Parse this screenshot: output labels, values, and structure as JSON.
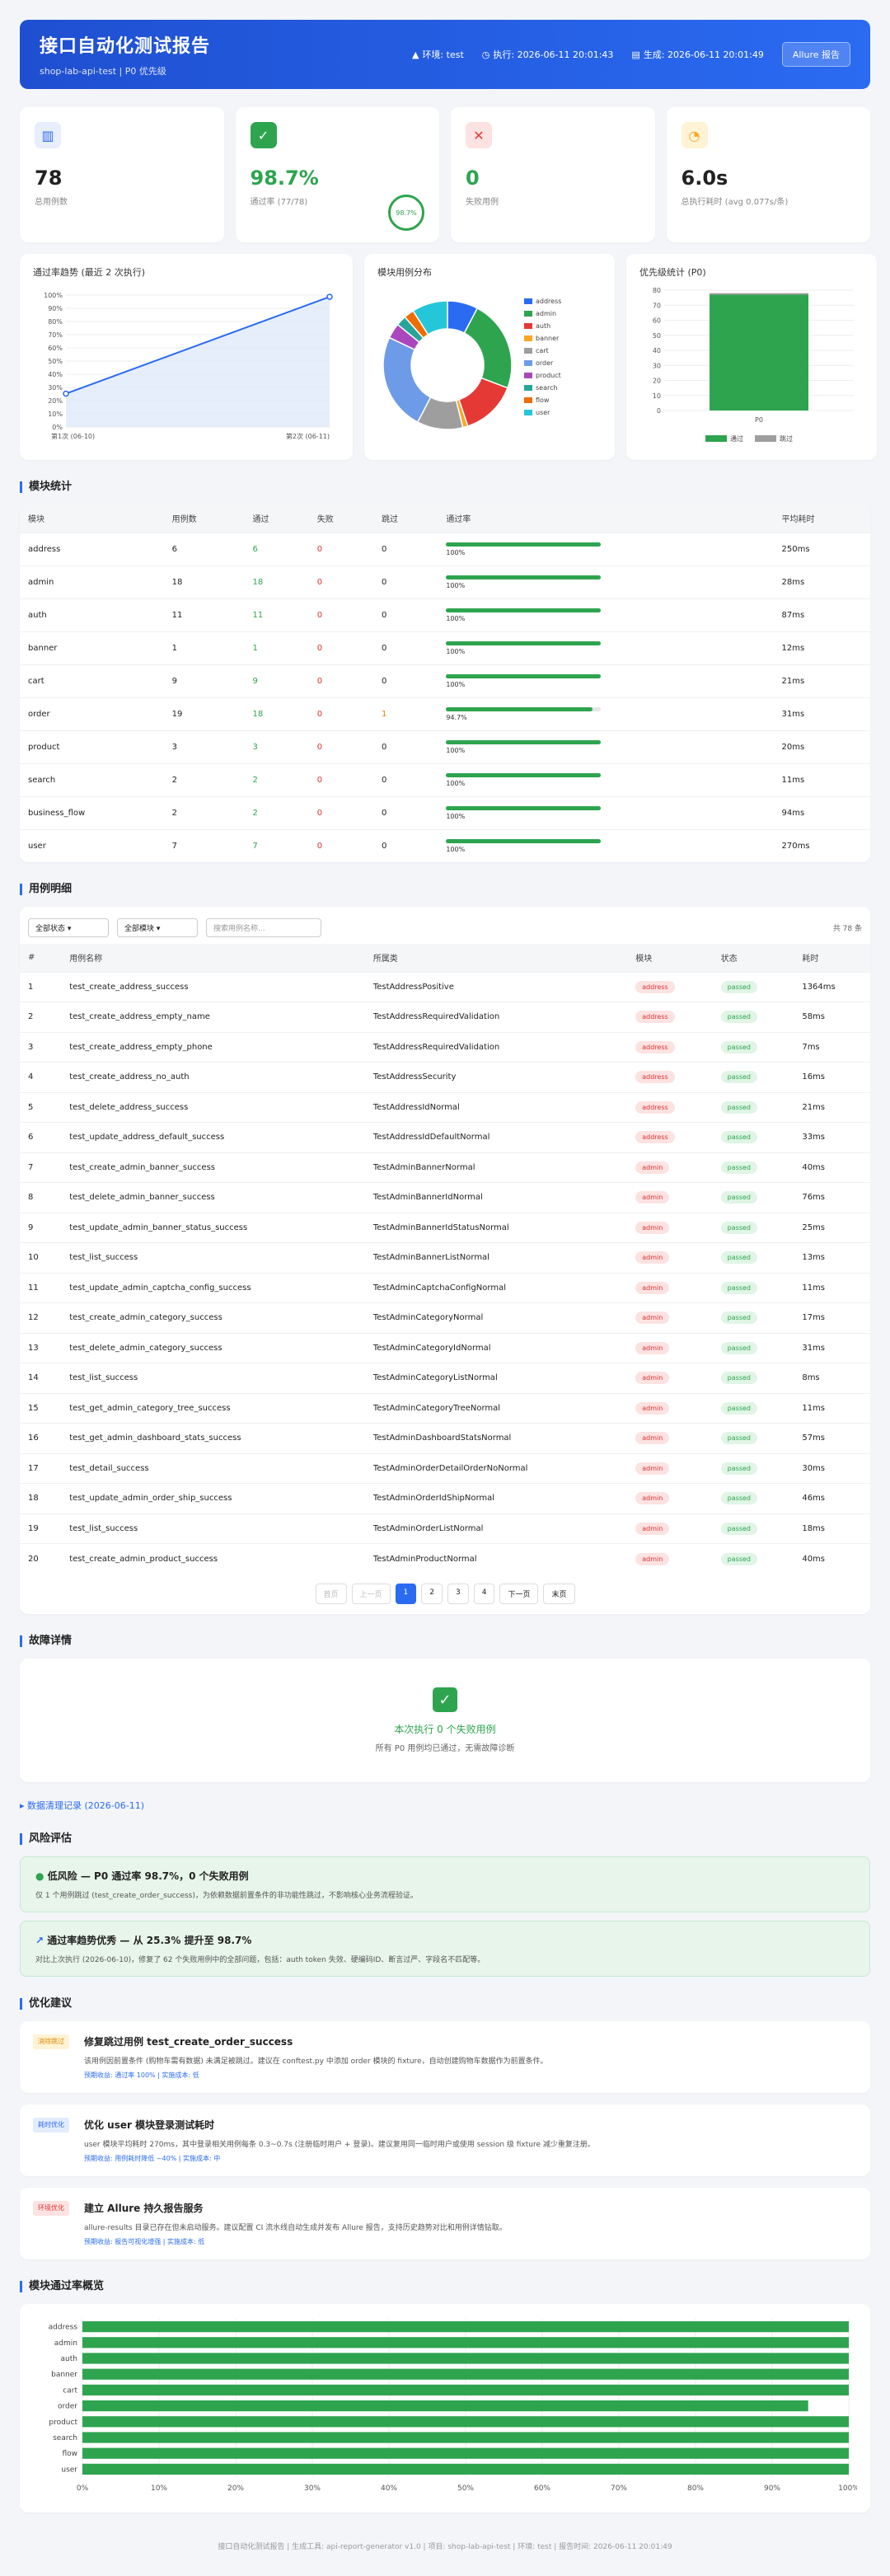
{
  "header": {
    "title": "接口自动化测试报告",
    "subtitle": "shop-lab-api-test | P0 优先级",
    "env": "环境: test",
    "exec": "执行: 2026-06-11 20:01:43",
    "gen": "生成: 2026-06-11 20:01:49",
    "allure": "Allure 报告"
  },
  "stats": [
    {
      "icon": "chart-icon",
      "value": "78",
      "label": "总用例数"
    },
    {
      "icon": "check-icon",
      "value": "98.7%",
      "label": "通过率 (77/78)",
      "ring": "98.7%"
    },
    {
      "icon": "cross-icon",
      "value": "0",
      "label": "失败用例"
    },
    {
      "icon": "clock-icon",
      "value": "6.0s",
      "label": "总执行耗时 (avg 0.077s/条)"
    }
  ],
  "charts": {
    "trend_title": "通过率趋势 (最近 2 次执行)",
    "pie_title": "模块用例分布",
    "prio_title": "优先级统计 (P0)",
    "pass_label": "通过",
    "skip_label": "跳过"
  },
  "chart_data": [
    {
      "type": "line",
      "title": "通过率趋势 (最近 2 次执行)",
      "x": [
        "第1次 (06-10)",
        "第2次 (06-11)"
      ],
      "series": [
        {
          "values": [
            25.3,
            98.7
          ]
        }
      ],
      "ylim": [
        0,
        100
      ],
      "yticks": [
        "0%",
        "10%",
        "20%",
        "30%",
        "40%",
        "50%",
        "60%",
        "70%",
        "80%",
        "90%",
        "100%"
      ]
    },
    {
      "type": "pie",
      "title": "模块用例分布",
      "labels": [
        "address",
        "admin",
        "auth",
        "banner",
        "cart",
        "order",
        "product",
        "search",
        "flow",
        "user"
      ],
      "values": [
        6,
        18,
        11,
        1,
        9,
        19,
        3,
        2,
        2,
        7
      ],
      "colors": [
        "#2a6bf2",
        "#2ea44f",
        "#e53935",
        "#f9a825",
        "#9e9e9e",
        "#6d9be8",
        "#ab47bc",
        "#26a69a",
        "#ef6c00",
        "#26c6da"
      ]
    },
    {
      "type": "bar",
      "title": "优先级统计 (P0)",
      "categories": [
        "P0"
      ],
      "series": [
        {
          "name": "通过",
          "values": [
            77
          ]
        },
        {
          "name": "跳过",
          "values": [
            1
          ]
        }
      ],
      "ylim": [
        0,
        80
      ],
      "yticks": [
        0,
        10,
        20,
        30,
        40,
        50,
        60,
        70,
        80
      ]
    },
    {
      "type": "bar",
      "orientation": "horizontal",
      "categories": [
        "address",
        "admin",
        "auth",
        "banner",
        "cart",
        "order",
        "product",
        "search",
        "flow",
        "user"
      ],
      "values": [
        100,
        100,
        100,
        100,
        100,
        94.7,
        100,
        100,
        100,
        100
      ],
      "xticks": [
        "0%",
        "10%",
        "20%",
        "30%",
        "40%",
        "50%",
        "60%",
        "70%",
        "80%",
        "90%",
        "100%"
      ],
      "xlim": [
        0,
        100
      ]
    }
  ],
  "module_stats": {
    "title": "模块统计",
    "headers": [
      "模块",
      "用例数",
      "通过",
      "失败",
      "跳过",
      "通过率",
      "平均耗时"
    ],
    "rows": [
      {
        "name": "address",
        "total": "6",
        "pass": "6",
        "fail": "0",
        "skip": "0",
        "rate": 100,
        "rate_label": "100%",
        "avg": "250ms"
      },
      {
        "name": "admin",
        "total": "18",
        "pass": "18",
        "fail": "0",
        "skip": "0",
        "rate": 100,
        "rate_label": "100%",
        "avg": "28ms"
      },
      {
        "name": "auth",
        "total": "11",
        "pass": "11",
        "fail": "0",
        "skip": "0",
        "rate": 100,
        "rate_label": "100%",
        "avg": "87ms"
      },
      {
        "name": "banner",
        "total": "1",
        "pass": "1",
        "fail": "0",
        "skip": "0",
        "rate": 100,
        "rate_label": "100%",
        "avg": "12ms"
      },
      {
        "name": "cart",
        "total": "9",
        "pass": "9",
        "fail": "0",
        "skip": "0",
        "rate": 100,
        "rate_label": "100%",
        "avg": "21ms"
      },
      {
        "name": "order",
        "total": "19",
        "pass": "18",
        "fail": "0",
        "skip": "1",
        "rate": 94.7,
        "rate_label": "94.7%",
        "avg": "31ms"
      },
      {
        "name": "product",
        "total": "3",
        "pass": "3",
        "fail": "0",
        "skip": "0",
        "rate": 100,
        "rate_label": "100%",
        "avg": "20ms"
      },
      {
        "name": "search",
        "total": "2",
        "pass": "2",
        "fail": "0",
        "skip": "0",
        "rate": 100,
        "rate_label": "100%",
        "avg": "11ms"
      },
      {
        "name": "business_flow",
        "total": "2",
        "pass": "2",
        "fail": "0",
        "skip": "0",
        "rate": 100,
        "rate_label": "100%",
        "avg": "94ms"
      },
      {
        "name": "user",
        "total": "7",
        "pass": "7",
        "fail": "0",
        "skip": "0",
        "rate": 100,
        "rate_label": "100%",
        "avg": "270ms"
      }
    ]
  },
  "cases": {
    "title": "用例明细",
    "status_filter": "全部状态",
    "module_filter": "全部模块",
    "search_placeholder": "搜索用例名称...",
    "count": "共 78 条",
    "headers": [
      "#",
      "用例名称",
      "所属类",
      "模块",
      "状态",
      "耗时"
    ],
    "rows": [
      [
        "1",
        "test_create_address_success",
        "TestAddressPositive",
        "address",
        "passed",
        "1364ms"
      ],
      [
        "2",
        "test_create_address_empty_name",
        "TestAddressRequiredValidation",
        "address",
        "passed",
        "58ms"
      ],
      [
        "3",
        "test_create_address_empty_phone",
        "TestAddressRequiredValidation",
        "address",
        "passed",
        "7ms"
      ],
      [
        "4",
        "test_create_address_no_auth",
        "TestAddressSecurity",
        "address",
        "passed",
        "16ms"
      ],
      [
        "5",
        "test_delete_address_success",
        "TestAddressIdNormal",
        "address",
        "passed",
        "21ms"
      ],
      [
        "6",
        "test_update_address_default_success",
        "TestAddressIdDefaultNormal",
        "address",
        "passed",
        "33ms"
      ],
      [
        "7",
        "test_create_admin_banner_success",
        "TestAdminBannerNormal",
        "admin",
        "passed",
        "40ms"
      ],
      [
        "8",
        "test_delete_admin_banner_success",
        "TestAdminBannerIdNormal",
        "admin",
        "passed",
        "76ms"
      ],
      [
        "9",
        "test_update_admin_banner_status_success",
        "TestAdminBannerIdStatusNormal",
        "admin",
        "passed",
        "25ms"
      ],
      [
        "10",
        "test_list_success",
        "TestAdminBannerListNormal",
        "admin",
        "passed",
        "13ms"
      ],
      [
        "11",
        "test_update_admin_captcha_config_success",
        "TestAdminCaptchaConfigNormal",
        "admin",
        "passed",
        "11ms"
      ],
      [
        "12",
        "test_create_admin_category_success",
        "TestAdminCategoryNormal",
        "admin",
        "passed",
        "17ms"
      ],
      [
        "13",
        "test_delete_admin_category_success",
        "TestAdminCategoryIdNormal",
        "admin",
        "passed",
        "31ms"
      ],
      [
        "14",
        "test_list_success",
        "TestAdminCategoryListNormal",
        "admin",
        "passed",
        "8ms"
      ],
      [
        "15",
        "test_get_admin_category_tree_success",
        "TestAdminCategoryTreeNormal",
        "admin",
        "passed",
        "11ms"
      ],
      [
        "16",
        "test_get_admin_dashboard_stats_success",
        "TestAdminDashboardStatsNormal",
        "admin",
        "passed",
        "57ms"
      ],
      [
        "17",
        "test_detail_success",
        "TestAdminOrderDetailOrderNoNormal",
        "admin",
        "passed",
        "30ms"
      ],
      [
        "18",
        "test_update_admin_order_ship_success",
        "TestAdminOrderIdShipNormal",
        "admin",
        "passed",
        "46ms"
      ],
      [
        "19",
        "test_list_success",
        "TestAdminOrderListNormal",
        "admin",
        "passed",
        "18ms"
      ],
      [
        "20",
        "test_create_admin_product_success",
        "TestAdminProductNormal",
        "admin",
        "passed",
        "40ms"
      ]
    ],
    "pager": {
      "first": "首页",
      "prev": "上一页",
      "p1": "1",
      "p2": "2",
      "p3": "3",
      "p4": "4",
      "next": "下一页",
      "last": "末页"
    }
  },
  "failures": {
    "title": "故障详情",
    "ok_title": "本次执行 0 个失败用例",
    "ok_sub": "所有 P0 用例均已通过，无需故障诊断",
    "cleanup": "▸ 数据清理记录 (2026-06-11)"
  },
  "risk": {
    "title": "风险评估",
    "items": [
      {
        "head": "低风险 — P0 通过率 98.7%，0 个失败用例",
        "body": "仅 1 个用例跳过 (test_create_order_success)，为依赖数据前置条件的非功能性跳过，不影响核心业务流程验证。"
      },
      {
        "head": "通过率趋势优秀 — 从 25.3% 提升至 98.7%",
        "body": "对比上次执行 (2026-06-10)，修复了 62 个失败用例中的全部问题，包括：auth token 失效、硬编码ID、断言过严、字段名不匹配等。"
      }
    ]
  },
  "optimize": {
    "title": "优化建议",
    "items": [
      {
        "tag": "消除跳过",
        "head": "修复跳过用例 test_create_order_success",
        "body": "该用例因前置条件 (购物车需有数据) 未满足被跳过。建议在 conftest.py 中添加 order 模块的 fixture，自动创建购物车数据作为前置条件。",
        "meta": "预期收益: 通过率 100% | 实施成本: 低"
      },
      {
        "tag": "耗时优化",
        "head": "优化 user 模块登录测试耗时",
        "body": "user 模块平均耗时 270ms，其中登录相关用例每条 0.3~0.7s (注册临时用户 + 登录)。建议复用同一临时用户或使用 session 级 fixture 减少重复注册。",
        "meta": "预期收益: 用例耗时降低 ~40% | 实施成本: 中"
      },
      {
        "tag": "环境优化",
        "head": "建立 Allure 持久报告服务",
        "body": "allure-results 目录已存在但未启动服务。建议配置 CI 流水线自动生成并发布 Allure 报告，支持历史趋势对比和用例详情钻取。",
        "meta": "预期收益: 报告可视化增强 | 实施成本: 低"
      }
    ]
  },
  "overview": {
    "title": "模块通过率概览"
  },
  "footer": "接口自动化测试报告 | 生成工具: api-report-generator v1.0 | 项目: shop-lab-api-test | 环境: test | 报告时间: 2026-06-11 20:01:49",
  "colors": {
    "accent": "#2a6bf2",
    "pass": "#2ea44f",
    "fail": "#d33",
    "skip": "#9e9e9e"
  }
}
